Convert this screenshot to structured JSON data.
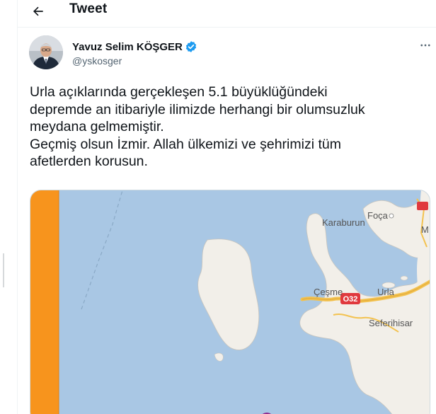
{
  "header": {
    "title": "Tweet",
    "back_icon": "arrow-left-icon"
  },
  "tweet": {
    "author": {
      "name": "Yavuz Selim KÖŞGER",
      "handle": "@yskosger",
      "verified_icon": "verified-badge-icon",
      "verified_color": "#1d9bf0"
    },
    "more_icon": "more-dots-icon",
    "text_lines": [
      "Urla açıklarında gerçekleşen 5.1 büyüklüğündeki",
      "depremde an itibariyle ilimizde herhangi bir olumsuzluk",
      "meydana gelmemiştir.",
      "Geçmiş olsun İzmir. Allah ülkemizi ve şehrimizi tüm",
      "afetlerden korusun."
    ],
    "media": {
      "type": "map",
      "labels": {
        "karaburun": "Karaburun",
        "foca": "Foça",
        "cesme": "Çeşme",
        "urla": "Urla",
        "seferihisar": "Seferihisar",
        "highway": "O32",
        "edge_m": "M"
      },
      "colors": {
        "sea": "#a9c7e4",
        "land": "#f2efe9",
        "border": "#f7941d",
        "road": "#f3c24f",
        "highway_badge": "#e0393e",
        "marker": "#8e2b8f"
      }
    }
  }
}
